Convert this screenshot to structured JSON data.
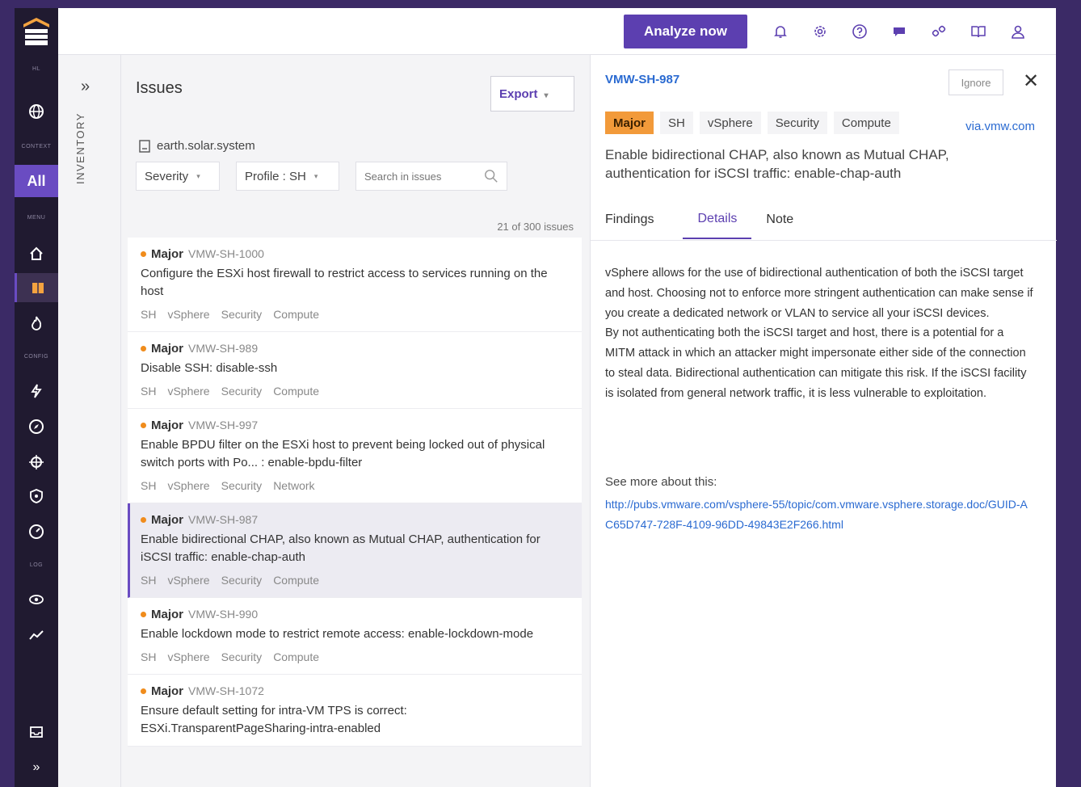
{
  "sidebar": {
    "labels": {
      "hl": "HL",
      "context": "CONTEXT",
      "menu": "MENU",
      "config": "CONFIG",
      "log": "LOG"
    },
    "all": "All",
    "expand": "»"
  },
  "topbar": {
    "analyze": "Analyze now"
  },
  "inventory": {
    "label": "INVENTORY",
    "chevron": "»"
  },
  "issues": {
    "title": "Issues",
    "export": "Export",
    "system": "earth.solar.system",
    "filters": {
      "severity": "Severity",
      "profile": "Profile : SH"
    },
    "search_placeholder": "Search in issues",
    "count": "21 of 300 issues",
    "items": [
      {
        "severity": "Major",
        "id": "VMW-SH-1000",
        "desc": "Configure the ESXi host firewall to restrict access to services running on the host",
        "tags": [
          "SH",
          "vSphere",
          "Security",
          "Compute"
        ]
      },
      {
        "severity": "Major",
        "id": "VMW-SH-989",
        "desc": "Disable SSH: disable-ssh",
        "tags": [
          "SH",
          "vSphere",
          "Security",
          "Compute"
        ]
      },
      {
        "severity": "Major",
        "id": "VMW-SH-997",
        "desc": "Enable BPDU filter on the ESXi host to prevent being locked out of physical switch ports with Po... : enable-bpdu-filter",
        "tags": [
          "SH",
          "vSphere",
          "Security",
          "Network"
        ]
      },
      {
        "severity": "Major",
        "id": "VMW-SH-987",
        "desc": "Enable bidirectional CHAP, also known as Mutual CHAP, authentication for iSCSI traffic: enable-chap-auth",
        "tags": [
          "SH",
          "vSphere",
          "Security",
          "Compute"
        ]
      },
      {
        "severity": "Major",
        "id": "VMW-SH-990",
        "desc": "Enable lockdown mode to restrict remote access: enable-lockdown-mode",
        "tags": [
          "SH",
          "vSphere",
          "Security",
          "Compute"
        ]
      },
      {
        "severity": "Major",
        "id": "VMW-SH-1072",
        "desc": "Ensure default setting for intra-VM TPS is correct: ESXi.TransparentPageSharing-intra-enabled",
        "tags": []
      }
    ]
  },
  "detail": {
    "id": "VMW-SH-987",
    "ignore": "Ignore",
    "close": "✕",
    "tags": [
      "Major",
      "SH",
      "vSphere",
      "Security",
      "Compute"
    ],
    "vendor": "via.vmw.com",
    "title": "Enable bidirectional CHAP, also known as Mutual CHAP, authentication for iSCSI traffic: enable-chap-auth",
    "tabs": [
      "Findings",
      "Details",
      "Note"
    ],
    "body1": "vSphere allows for the use of bidirectional authentication of both the iSCSI target and host. Choosing not to enforce more stringent authentication can make sense if you create a dedicated network or VLAN to service all your iSCSI devices.",
    "body2": "By not authenticating both the iSCSI target and host, there is a potential for a MITM attack in which an attacker might impersonate either side of the connection to steal data. Bidirectional authentication can mitigate this risk. If the iSCSI facility is isolated from general network traffic, it is less vulnerable to exploitation.",
    "see_more": "See more about this:",
    "link": "http://pubs.vmware.com/vsphere-55/topic/com.vmware.vsphere.storage.doc/GUID-AC65D747-728F-4109-96DD-49843E2F266.html"
  }
}
